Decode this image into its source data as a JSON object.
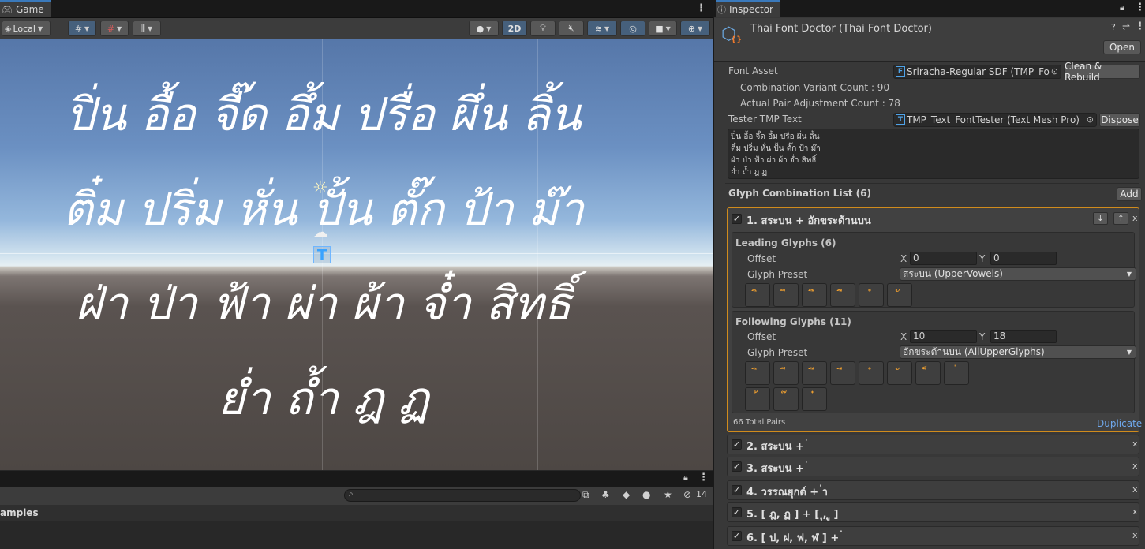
{
  "game": {
    "tab_title": "Game",
    "toolbar": {
      "pivot_label": "Local",
      "mode_2d_label": "2D"
    },
    "thai_lines": [
      "ปิ่น อื้อ จี๊ด อึ้ม ปรื่อ ผึ่น ลิ้น",
      "ติ๋ม ปริ่ม หั่น ปั้น ตั๊ก ป้า ม๊า",
      "ฝ่า ป่า ฟ้า ผ่า ผ้า จ๋ำ สิทธิ์",
      "ย่ำ ถ้ำ ฎ ฏ"
    ]
  },
  "console": {
    "search_placeholder": "",
    "hidden_count": "14",
    "row_label": "amples"
  },
  "inspector": {
    "tab_title": "Inspector",
    "header": {
      "title": "Thai Font Doctor (Thai Font Doctor)",
      "open_label": "Open"
    },
    "font_asset": {
      "label": "Font Asset",
      "value": "Sriracha-Regular SDF (TMP_Fo",
      "rebuild_label": "Clean & Rebuild"
    },
    "variant_count": "Combination Variant Count : 90",
    "pair_count": "Actual Pair Adjustment Count : 78",
    "tester": {
      "label": "Tester TMP Text",
      "value": "TMP_Text_FontTester (Text Mesh Pro)",
      "dispose_label": "Dispose",
      "text": "ปิ่น อื้อ จี๊ด อึ้ม ปรื่อ ผึ่น ลิ้น\nติ๋ม ปริ่ม หั่น ปั้น ตั๊ก ป้า ม๊า\nฝ่า ป่า ฟ้า ผ่า ผ้า จ๋ำ สิทธิ์\nย่ำ ถ้ำ ฎ ฏ"
    },
    "list": {
      "title": "Glyph  Combination List (6)",
      "add_label": "Add"
    },
    "entry1": {
      "title": "1. สระบน + อักขระด้านบน",
      "leading": {
        "title": "Leading Glyphs (6)",
        "offset_label": "Offset",
        "x_label": "X",
        "x": "0",
        "y_label": "Y",
        "y": "0",
        "preset_label": "Glyph Preset",
        "preset_value": "สระบน (UpperVowels)",
        "glyphs": [
          "ิ",
          "ี",
          "ึ",
          "ื",
          "ํ",
          "ั"
        ]
      },
      "following": {
        "title": "Following Glyphs (11)",
        "offset_label": "Offset",
        "x_label": "X",
        "x": "10",
        "y_label": "Y",
        "y": "18",
        "preset_label": "Glyph Preset",
        "preset_value": "อักขระด้านบน (AllUpperGlyphs)",
        "glyphs": [
          "ิ",
          "ี",
          "ึ",
          "ื",
          "ํ",
          "ั",
          "็",
          "่",
          "้",
          "๊",
          "๋"
        ]
      },
      "total_pairs": "66 Total Pairs",
      "duplicate_label": "Duplicate"
    },
    "entries": [
      {
        "title": "2. สระบน + ่"
      },
      {
        "title": "3. สระบน + ่"
      },
      {
        "title": "4. วรรณยุกต์ + ่า"
      },
      {
        "title": "5. [ ฎ, ฏ ] + [ ุ, ู ]"
      },
      {
        "title": "6. [ ป, ฝ, ฟ, ฬ ] + ่"
      }
    ]
  }
}
